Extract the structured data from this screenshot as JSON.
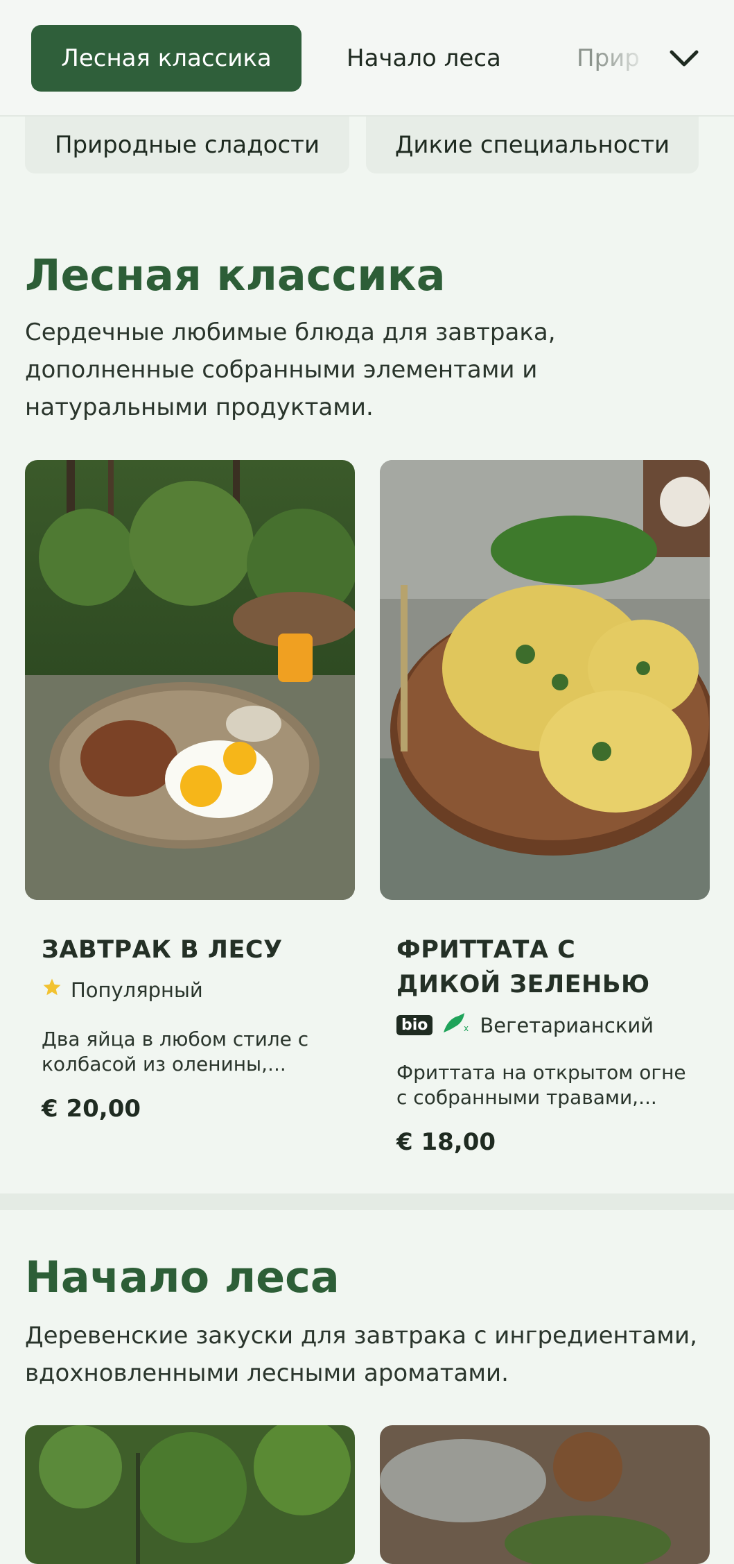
{
  "nav": {
    "tabs": [
      "Лесная классика",
      "Начало леса",
      "Прир"
    ],
    "active_index": 0,
    "more_icon": "chevron-down-icon",
    "row2": [
      "Природные сладости",
      "Дикие специальности"
    ]
  },
  "sections": [
    {
      "title": "Лесная классика",
      "description": "Сердечные любимые блюда для завтрака, дополненные собранными элементами и натуральными продуктами.",
      "items": [
        {
          "title": "ЗАВТРАК В ЛЕСУ",
          "tag_icon": "star-icon",
          "tag": "Популярный",
          "description": "Два яйца в любом стиле с колбасой из оленины,...",
          "price": "€ 20,00"
        },
        {
          "title": "ФРИТТАТА С ДИКОЙ ЗЕЛЕНЬЮ",
          "badge": "bio",
          "tag_icon": "vegetarian-icon",
          "tag": "Вегетарианский",
          "description": "Фриттата на открытом огне с собранными травами,...",
          "price": "€ 18,00"
        }
      ]
    },
    {
      "title": "Начало леса",
      "description": "Деревенские закуски для завтрака с ингредиентами, вдохновленными лесными ароматами."
    }
  ],
  "colors": {
    "accent": "#2f5f3a",
    "heading": "#2d5e37",
    "background": "#f1f6f1",
    "star": "#f2c230"
  }
}
